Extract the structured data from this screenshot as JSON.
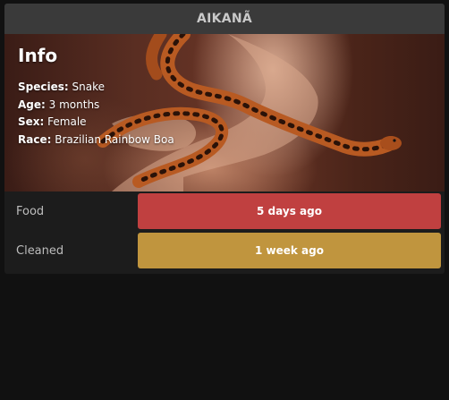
{
  "card": {
    "title": "AIKANÃ"
  },
  "info": {
    "heading": "Info",
    "fields": [
      {
        "label": "Species:",
        "value": "Snake"
      },
      {
        "label": "Age:",
        "value": "3 months"
      },
      {
        "label": "Sex:",
        "value": "Female"
      },
      {
        "label": "Race:",
        "value": "Brazilian Rainbow Boa"
      }
    ]
  },
  "status": [
    {
      "label": "Food",
      "value": "5 days ago",
      "color": "#c04040"
    },
    {
      "label": "Cleaned",
      "value": "1 week ago",
      "color": "#c0953e"
    }
  ],
  "colors": {
    "page_bg": "#111111",
    "card_bg": "#1c1c1c",
    "header_bg": "#3a3a3a"
  }
}
